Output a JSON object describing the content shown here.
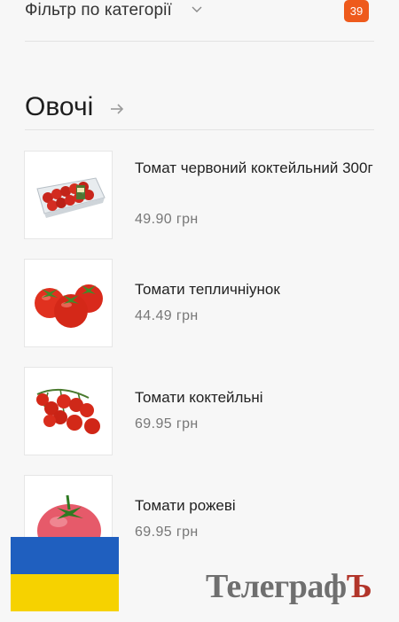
{
  "filter": {
    "label": "Фільтр по категорії",
    "count": "39"
  },
  "section": {
    "title": "Овочі"
  },
  "products": [
    {
      "name": "Томат червоний коктейльний 300г",
      "price": "49.90 грн",
      "image": "cherry-tomato-pack"
    },
    {
      "name": "Томати тепличніунок",
      "price": "44.49 грн",
      "image": "greenhouse-tomatoes"
    },
    {
      "name": "Томати коктейльні",
      "price": "69.95 грн",
      "image": "cocktail-tomato-vine"
    },
    {
      "name": "Томати рожеві",
      "price": "69.95 грн",
      "image": "pink-tomato"
    }
  ],
  "overlay": {
    "flag": "ukraine-flag",
    "watermark_main": "Телеграф",
    "watermark_tail": "Ъ"
  },
  "colors": {
    "badge": "#ee5a1c",
    "flag_blue": "#1f5fbf",
    "flag_yellow": "#f6d200",
    "watermark_accent": "#b2352a"
  }
}
